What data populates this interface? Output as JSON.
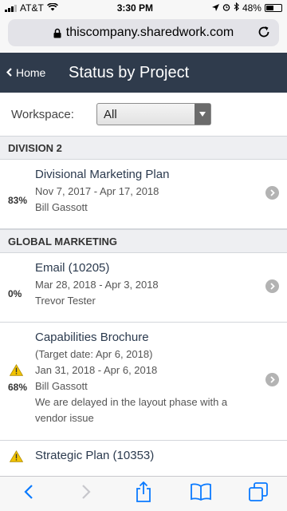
{
  "status_bar": {
    "carrier": "AT&T",
    "time": "3:30 PM",
    "battery": "48%",
    "battery_level": 0.48
  },
  "browser": {
    "url": "thiscompany.sharedwork.com"
  },
  "header": {
    "back_label": "Home",
    "title": "Status by Project"
  },
  "filter": {
    "label": "Workspace:",
    "value": "All"
  },
  "sections": [
    {
      "name": "DIVISION 2",
      "projects": [
        {
          "name": "Divisional Marketing Plan",
          "percent": "83%",
          "dates": "Nov 7, 2017 - Apr 17, 2018",
          "owner": "Bill Gassott"
        }
      ]
    },
    {
      "name": "GLOBAL MARKETING",
      "projects": [
        {
          "name": "Email (10205)",
          "percent": "0%",
          "dates": "Mar 28, 2018 - Apr 3, 2018",
          "owner": "Trevor Tester"
        },
        {
          "name": "Capabilities Brochure",
          "percent": "68%",
          "target": "(Target date: Apr 6, 2018)",
          "dates": "Jan 31, 2018 - Apr 6, 2018",
          "owner": "Bill Gassott",
          "note": "We are delayed in the layout phase with a vendor issue",
          "warning": true
        },
        {
          "name": "Strategic Plan (10353)",
          "warning": true
        }
      ]
    }
  ],
  "colors": {
    "header_bg": "#2f3b4c",
    "ios_blue": "#0a7aff",
    "warning": "#f2c300"
  },
  "icons": {
    "back": "chevron-left-icon",
    "forward": "chevron-right-icon",
    "share": "share-icon",
    "bookmarks": "book-icon",
    "tabs": "tabs-icon"
  }
}
